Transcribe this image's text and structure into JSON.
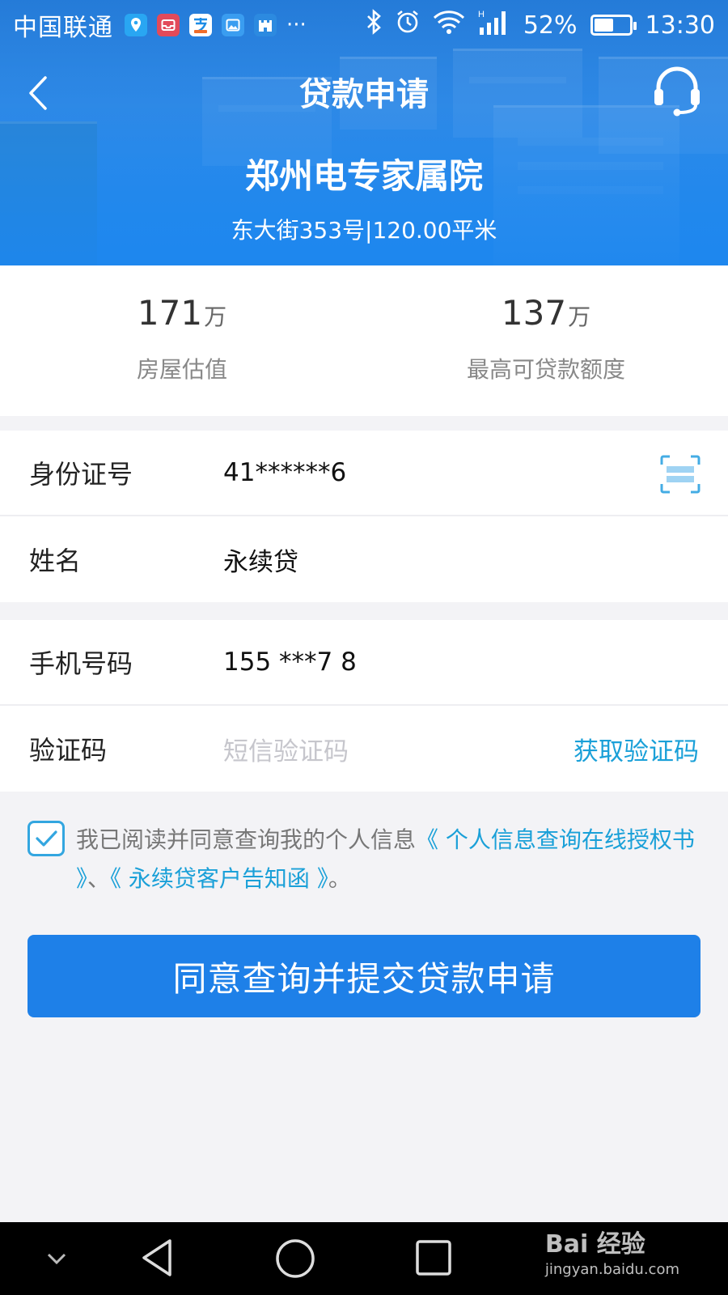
{
  "status_bar": {
    "carrier": "中国联通",
    "more": "···",
    "battery": "52%",
    "battery_level": 0.52,
    "time": "13:30",
    "icons": [
      "location-app-icon",
      "inbox-app-icon",
      "alipay-app-icon",
      "gallery-app-icon",
      "castle-app-icon",
      "bluetooth-icon",
      "alarm-icon",
      "wifi-icon",
      "signal-icon"
    ]
  },
  "header": {
    "title": "贷款申请",
    "back_icon": "chevron-left-icon",
    "service_icon": "headset-icon",
    "estate_name": "郑州电专家属院",
    "estate_info": "东大街353号|120.00平米"
  },
  "valuation": {
    "house_value": "171",
    "house_value_unit": "万",
    "house_value_label": "房屋估值",
    "max_loan": "137",
    "max_loan_unit": "万",
    "max_loan_label": "最高可贷款额度"
  },
  "form": {
    "id_label": "身份证号",
    "id_value": "41******6",
    "name_label": "姓名",
    "name_value": "永续贷",
    "phone_label": "手机号码",
    "phone_value": "155 ***7 8",
    "code_label": "验证码",
    "code_placeholder": "短信验证码",
    "get_code": "获取验证码"
  },
  "agreement": {
    "checked": true,
    "text": "我已阅读并同意查询我的个人信息",
    "link1": "《 个人信息查询在线授权书 》",
    "sep": "、",
    "link2": "《 永续贷客户告知函 》",
    "end": "。"
  },
  "submit_label": "同意查询并提交贷款申请",
  "watermark": {
    "brand": "Bai 经验",
    "url": "jingyan.baidu.com"
  },
  "colors": {
    "primary": "#1e80e8",
    "link": "#1aa0d8",
    "header": "#2a7fd6"
  }
}
